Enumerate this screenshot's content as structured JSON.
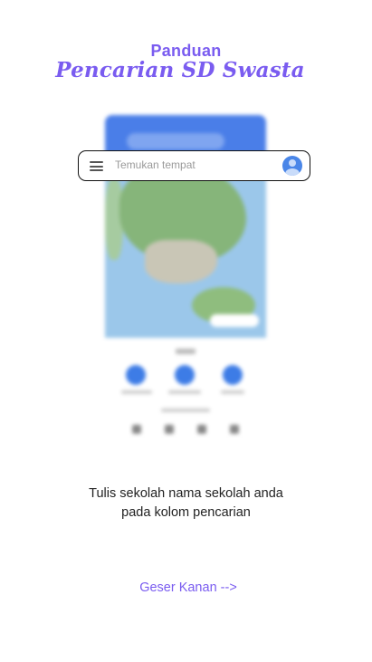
{
  "header": {
    "subtitle": "Panduan",
    "title": "Pencarian SD Swasta"
  },
  "search_bar": {
    "placeholder": "Temukan tempat"
  },
  "instruction": {
    "line1": "Tulis sekolah nama sekolah anda",
    "line2": "pada kolom pencarian"
  },
  "navigation": {
    "swipe_label": "Geser Kanan -->"
  },
  "colors": {
    "accent": "#7a5cf0",
    "map_blue": "#4a7ee8"
  }
}
